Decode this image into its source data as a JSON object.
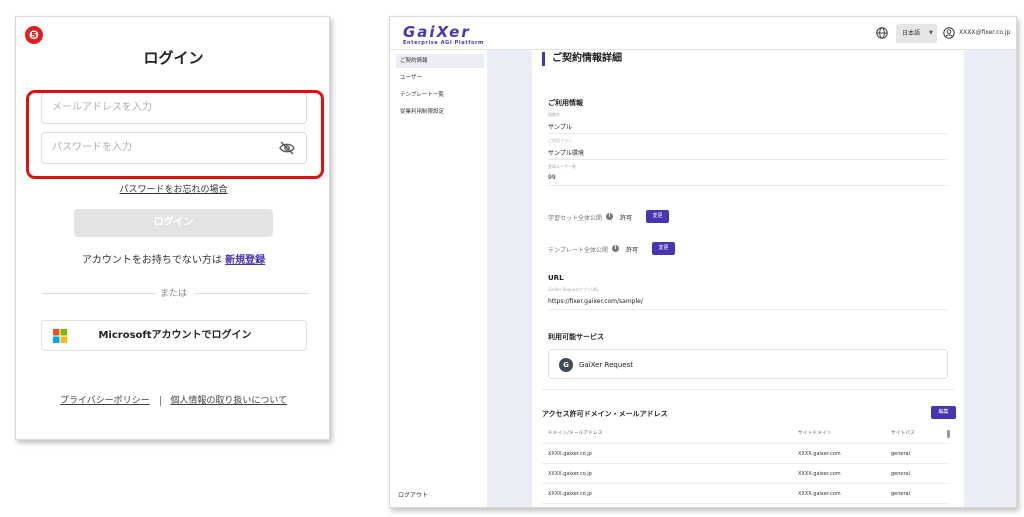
{
  "login": {
    "step_badge": "❺",
    "title": "ログイン",
    "email_placeholder": "メールアドレスを入力",
    "password_placeholder": "パスワードを入力",
    "forgot_password": "パスワードをお忘れの場合",
    "login_button": "ログイン",
    "no_account_text": "アカウントをお持ちでない方は",
    "register_link": "新規登録",
    "or_text": "または",
    "microsoft_button": "Microsoftアカウントでログイン",
    "privacy_policy": "プライバシーポリシー",
    "personal_info": "個人情報の取り扱いについて",
    "highlight_color": "#e01010"
  },
  "app": {
    "brand": "GaiXer",
    "brand_subtitle": "Enterprise AGI Platform",
    "language": "日本語",
    "user_email": "XXXX@fixer.co.jp",
    "accent_color": "#4a35b0",
    "sidebar": {
      "items": [
        {
          "label": "ご契約情報",
          "active": true
        },
        {
          "label": "ユーザー"
        },
        {
          "label": "テンプレート一覧"
        },
        {
          "label": "従業利用制限設定"
        }
      ],
      "logout": "ログアウト"
    },
    "page_title": "ご契約情報詳細",
    "usage": {
      "title": "ご利用情報",
      "org_label": "組織名",
      "org_value": "サンプル",
      "plan_label": "ご利用プラン",
      "plan_value": "サンプル環境",
      "users_label": "登録ユーザー数",
      "users_value": "99",
      "learning_set_label": "学習セット全体公開",
      "learning_set_status": "許可",
      "template_label": "テンプレート全体公開",
      "template_status": "許可",
      "change_button": "変更",
      "info_glyph": "i"
    },
    "url": {
      "title": "URL",
      "label": "GaiXer RequestアプリURL",
      "value": "https://fixer.gaixer.com/sample/"
    },
    "services": {
      "title": "利用可能サービス",
      "icon_glyph": "G",
      "items": [
        {
          "name": "GaiXer Request"
        }
      ]
    },
    "access": {
      "title": "アクセス許可ドメイン・メールアドレス",
      "edit_button": "編集",
      "columns": [
        "ドメイン/メールアドレス",
        "サイトドメイン",
        "サイトパス"
      ],
      "rows": [
        [
          "XXXX.gaixer.co.jp",
          "XXXX.gaixer.com",
          "general"
        ],
        [
          "XXXX.gaixer.co.jp",
          "XXXX.gaixer.com",
          "general"
        ],
        [
          "XXXX.gaixer.co.jp",
          "XXXX.gaixer.com",
          "general"
        ]
      ]
    }
  }
}
